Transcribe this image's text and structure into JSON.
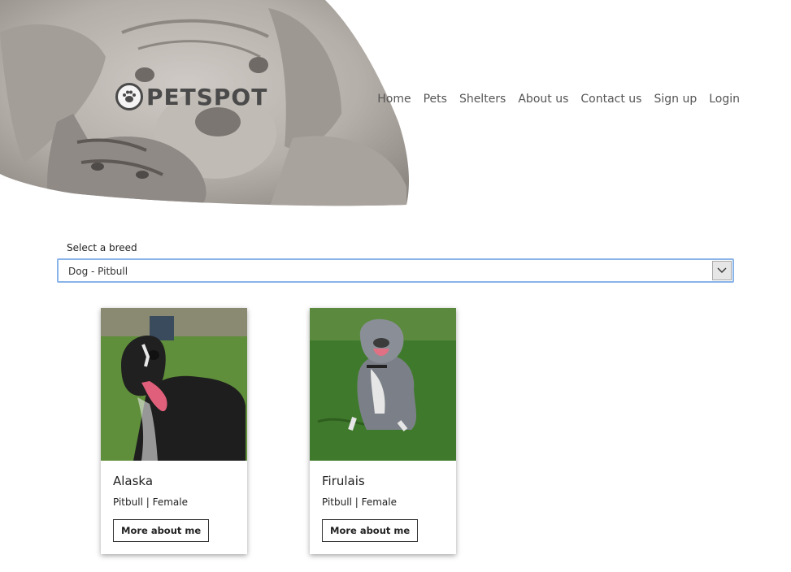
{
  "header": {
    "logo_text": "PETSPOT",
    "nav": [
      {
        "label": "Home"
      },
      {
        "label": "Pets"
      },
      {
        "label": "Shelters"
      },
      {
        "label": "About us"
      },
      {
        "label": "Contact us"
      },
      {
        "label": "Sign up"
      },
      {
        "label": "Login"
      }
    ]
  },
  "filter": {
    "label": "Select a breed",
    "selected": "Dog - Pitbull"
  },
  "pets": [
    {
      "name": "Alaska",
      "details": "Pitbull | Female",
      "button_label": "More about me"
    },
    {
      "name": "Firulais",
      "details": "Pitbull | Female",
      "button_label": "More about me"
    }
  ],
  "colors": {
    "select_border": "#8ab4e8",
    "hero_tone": "#b8b2ac"
  }
}
